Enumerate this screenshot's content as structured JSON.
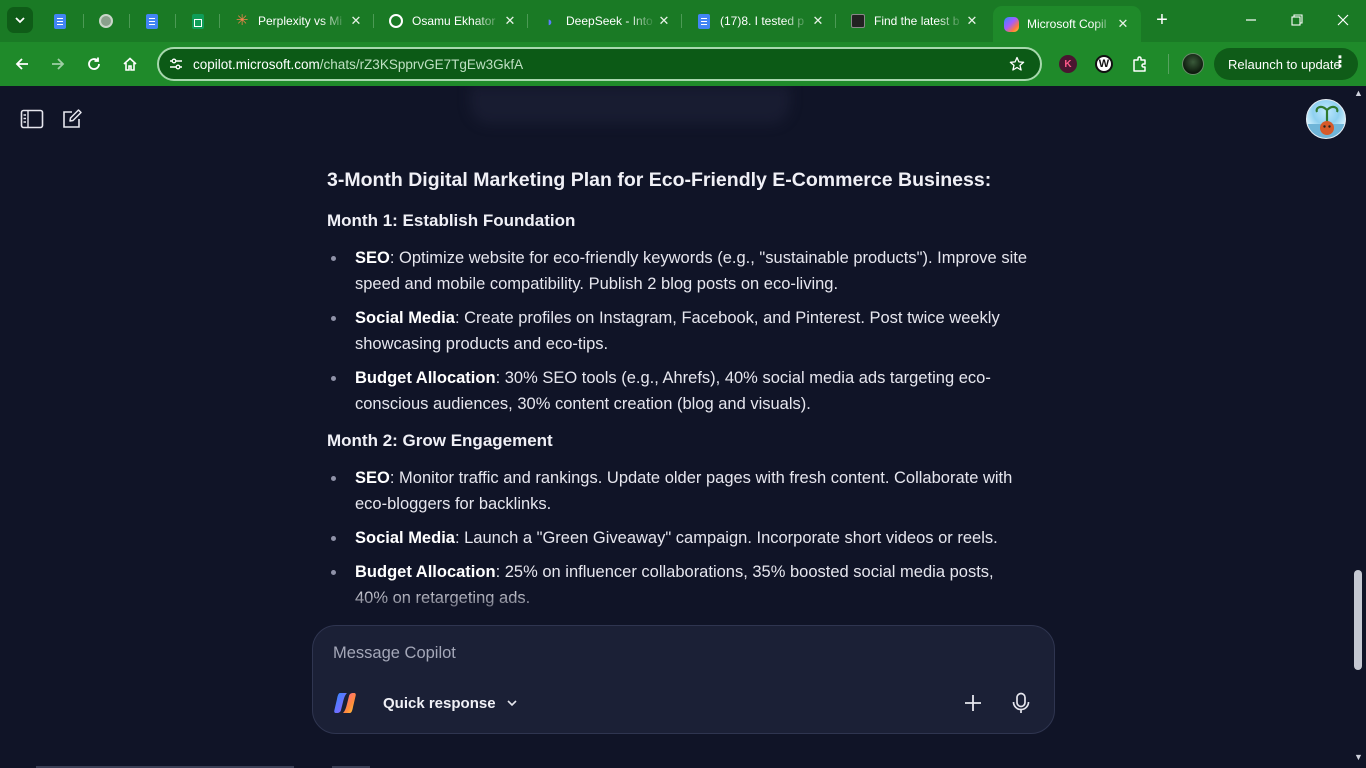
{
  "browser": {
    "tabs": [
      {
        "title": "",
        "icon": "google-docs-icon"
      },
      {
        "title": "",
        "icon": "globe-icon"
      },
      {
        "title": "",
        "icon": "google-docs-icon"
      },
      {
        "title": "",
        "icon": "google-sheets-icon"
      },
      {
        "title": "Perplexity vs Mi",
        "icon": "perplexity-icon"
      },
      {
        "title": "Osamu Ekhator",
        "icon": "github-icon"
      },
      {
        "title": "DeepSeek - Into",
        "icon": "deepseek-icon"
      },
      {
        "title": "(17)8. I tested p",
        "icon": "google-docs-icon"
      },
      {
        "title": "Find the latest b",
        "icon": "dark-site-icon"
      },
      {
        "title": "Microsoft Copil",
        "icon": "copilot-icon",
        "active": true
      }
    ],
    "new_tab_symbol": "+",
    "url_host": "copilot.microsoft.com",
    "url_path": "/chats/rZ3KSpprvGE7TgEw3GkfA",
    "relaunch_label": "Relaunch to update",
    "extensions": {
      "k_label": "K",
      "w_label": "W"
    },
    "colors": {
      "frame": "#1a7a25",
      "toolbar": "#1f8a2a",
      "omnibox": "#0c5a16"
    }
  },
  "copilot": {
    "colors": {
      "background": "#101427",
      "composer": "#1b2036",
      "text": "#e6e6ee"
    },
    "response": {
      "title": "3-Month Digital Marketing Plan for Eco-Friendly E-Commerce Business:",
      "months": [
        {
          "heading": "Month 1: Establish Foundation",
          "items": [
            {
              "label": "SEO",
              "text": ": Optimize website for eco-friendly keywords (e.g., \"sustainable products\"). Improve site speed and mobile compatibility. Publish 2 blog posts on eco-living."
            },
            {
              "label": "Social Media",
              "text": ": Create profiles on Instagram, Facebook, and Pinterest. Post twice weekly showcasing products and eco-tips."
            },
            {
              "label": "Budget Allocation",
              "text": ": 30% SEO tools (e.g., Ahrefs), 40% social media ads targeting eco-conscious audiences, 30% content creation (blog and visuals)."
            }
          ]
        },
        {
          "heading": "Month 2: Grow Engagement",
          "items": [
            {
              "label": "SEO",
              "text": ": Monitor traffic and rankings. Update older pages with fresh content. Collaborate with eco-bloggers for backlinks."
            },
            {
              "label": "Social Media",
              "text": ": Launch a \"Green Giveaway\" campaign. Incorporate short videos or reels."
            },
            {
              "label": "Budget Allocation",
              "text": ": 25% on influencer collaborations, 35% boosted social media posts, 40% on retargeting ads."
            }
          ]
        }
      ]
    },
    "composer": {
      "placeholder": "Message Copilot",
      "mode_label": "Quick response"
    }
  }
}
